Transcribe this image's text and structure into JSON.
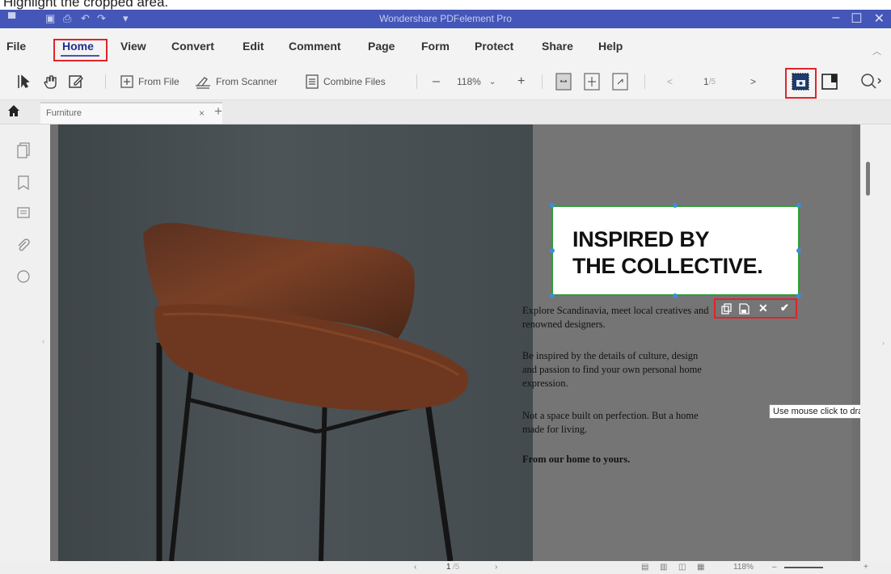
{
  "caption": "Highlight the cropped area.",
  "window": {
    "title": "Wondershare PDFelement Pro",
    "controls": [
      "–",
      "☐",
      "✕"
    ]
  },
  "menu": {
    "items": [
      "File",
      "Home",
      "View",
      "Convert",
      "Edit",
      "Comment",
      "Page",
      "Form",
      "Protect",
      "Share",
      "Help"
    ],
    "active": "Home"
  },
  "toolbar": {
    "from_file": "From File",
    "from_scanner": "From Scanner",
    "combine_files": "Combine Files",
    "zoom_out": "–",
    "zoom_value": "118%",
    "zoom_in": "+",
    "page_prev": "<",
    "page_current": "1",
    "page_total": "/5",
    "page_next": ">"
  },
  "tabs": {
    "items": [
      {
        "label": "Furniture",
        "close": "×"
      }
    ],
    "add": "+"
  },
  "document": {
    "headline_1": "INSPIRED BY",
    "headline_2": "THE COLLECTIVE.",
    "para1": "Explore Scandinavia, meet local creatives and renowned designers.",
    "para2": "Be inspired by the details of culture, design and passion to find your own personal home expression.",
    "para3": "Not a space built on perfection. But a home made for living.",
    "para4": "From our home to yours."
  },
  "capture_bar": {
    "icons": [
      "copy-icon",
      "save-icon",
      "cancel-icon",
      "confirm-icon"
    ],
    "cancel_glyph": "✕",
    "confirm_glyph": "✔"
  },
  "tooltip": "Use mouse click to drag the",
  "status": {
    "page_current": "1",
    "page_total": "/5",
    "zoom": "118%",
    "zoom_out": "–",
    "zoom_in": "+"
  },
  "colors": {
    "title_bar": "#4456b8",
    "highlight_red": "#e0242a",
    "selection_green": "#2f9e39",
    "handle_blue": "#3a8ed6",
    "chair_leather": "#8a4a2a"
  }
}
